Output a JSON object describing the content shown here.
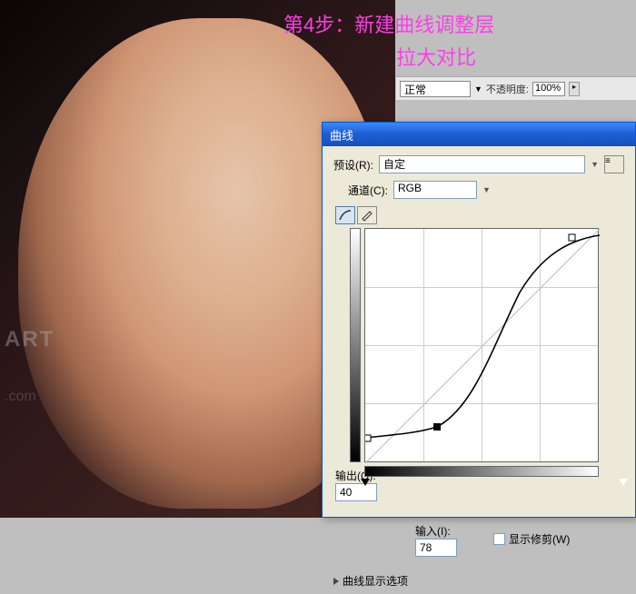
{
  "annotation": {
    "line1": "第4步：新建曲线调整层",
    "line2": "拉大对比"
  },
  "layers_panel": {
    "blend_mode": "正常",
    "opacity_label": "不透明度:",
    "opacity_value": "100%"
  },
  "curves_dialog": {
    "title": "曲线",
    "preset_label": "预设(R):",
    "preset_value": "自定",
    "channel_label": "通道(C):",
    "channel_value": "RGB",
    "output_label": "输出(O):",
    "output_value": "40",
    "input_label": "输入(I):",
    "input_value": "78",
    "show_clipping_label": "显示修剪(W)",
    "disclosure_label": "曲线显示选项"
  },
  "watermark": {
    "primary": "ART",
    "secondary": ".com"
  },
  "chart_data": {
    "type": "line",
    "title": "Curves",
    "xlabel": "输入",
    "ylabel": "输出",
    "xlim": [
      0,
      255
    ],
    "ylim": [
      0,
      255
    ],
    "series": [
      {
        "name": "curve",
        "points": [
          {
            "x": 0,
            "y": 28
          },
          {
            "x": 78,
            "y": 40
          },
          {
            "x": 150,
            "y": 160
          },
          {
            "x": 225,
            "y": 245
          },
          {
            "x": 255,
            "y": 250
          }
        ]
      },
      {
        "name": "baseline",
        "points": [
          {
            "x": 0,
            "y": 0
          },
          {
            "x": 255,
            "y": 255
          }
        ]
      }
    ]
  }
}
